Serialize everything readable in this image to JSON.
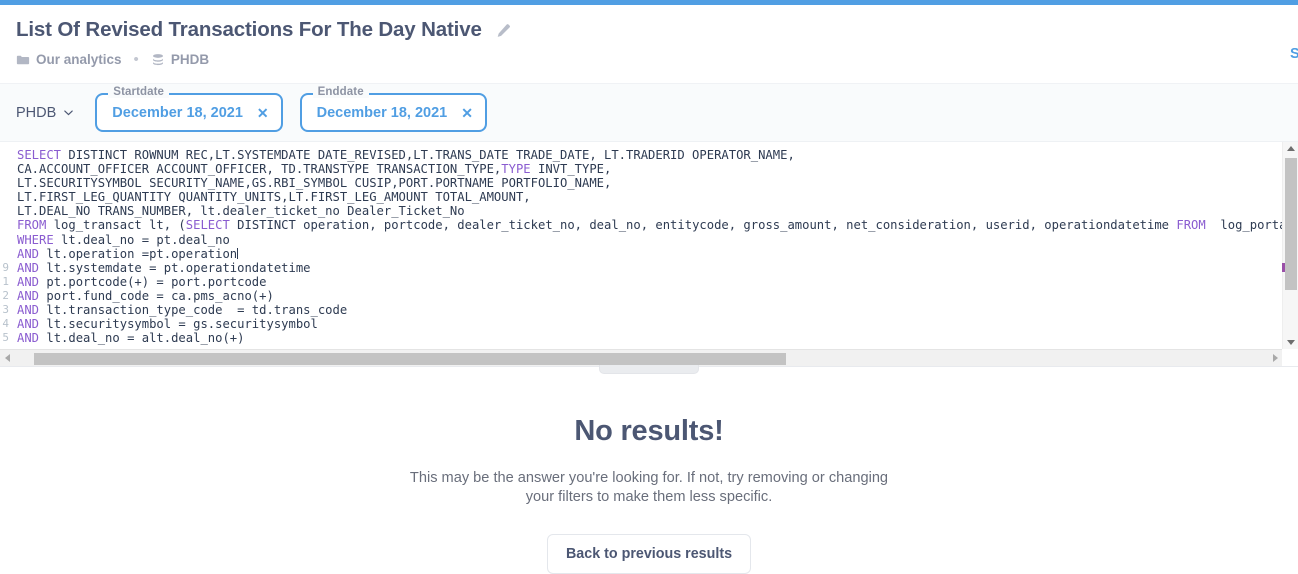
{
  "theme": {
    "accent": "#509ee3",
    "text_dark": "#4c5773",
    "text_muted": "#949aab",
    "keyword_purple": "#8a5cd0",
    "filter_bar_bg": "#f9fbfc"
  },
  "header": {
    "title": "List Of Revised Transactions For The Day Native",
    "edit_icon": "pencil-icon",
    "breadcrumb": {
      "collection": "Our analytics",
      "collection_icon": "folder-icon",
      "separator": "•",
      "database": "PHDB",
      "database_icon": "database-icon"
    },
    "right_link_clipped": "Save"
  },
  "filter_bar": {
    "database_picker": {
      "label": "PHDB",
      "chevron_icon": "chevron-down-icon"
    },
    "filters": [
      {
        "legend": "Startdate",
        "value": "December 18, 2021",
        "clear_icon": "✕"
      },
      {
        "legend": "Enddate",
        "value": "December 18, 2021",
        "clear_icon": "✕"
      }
    ]
  },
  "editor": {
    "language": "sql",
    "gutter_line_numbers": [
      "",
      "",
      "",
      "",
      "",
      "",
      "",
      "",
      "9",
      "1",
      "2",
      "3",
      "4",
      "5"
    ],
    "scrollbars": {
      "vertical_thumb_pct": 63,
      "horizontal_thumb_pct": 60,
      "up_icon": "triangle-up-icon",
      "down_icon": "triangle-down-icon",
      "left_icon": "triangle-left-icon",
      "right_icon": "triangle-right-icon"
    },
    "lines": [
      [
        {
          "t": "SELECT",
          "k": true
        },
        {
          "t": " DISTINCT ROWNUM REC,LT.SYSTEMDATE DATE_REVISED,LT.TRANS_DATE TRADE_DATE, LT.TRADERID OPERATOR_NAME,",
          "k": false
        }
      ],
      [
        {
          "t": "CA.ACCOUNT_OFFICER ACCOUNT_OFFICER, TD.TRANSTYPE TRANSACTION_TYPE,",
          "k": false
        },
        {
          "t": "TYPE",
          "k": true
        },
        {
          "t": " INVT_TYPE,",
          "k": false
        }
      ],
      [
        {
          "t": "LT.SECURITYSYMBOL SECURITY_NAME,GS.RBI_SYMBOL CUSIP,PORT.PORTNAME PORTFOLIO_NAME,",
          "k": false
        }
      ],
      [
        {
          "t": "LT.FIRST_LEG_QUANTITY QUANTITY_UNITS,LT.FIRST_LEG_AMOUNT TOTAL_AMOUNT,",
          "k": false
        }
      ],
      [
        {
          "t": "LT.DEAL_NO TRANS_NUMBER, lt.dealer_ticket_no Dealer_Ticket_No",
          "k": false
        }
      ],
      [
        {
          "t": "FROM",
          "k": true
        },
        {
          "t": " log_transact lt, (",
          "k": false
        },
        {
          "t": "SELECT",
          "k": true
        },
        {
          "t": " DISTINCT operation, portcode, dealer_ticket_no, deal_no, entitycode, gross_amount, net_consideration, userid, operationdatetime ",
          "k": false
        },
        {
          "t": "FROM",
          "k": true
        },
        {
          "t": "  log_portallocation) pt, ",
          "k": false
        }
      ],
      [
        {
          "t": "WHERE",
          "k": true
        },
        {
          "t": " lt.deal_no = pt.deal_no",
          "k": false
        }
      ],
      [
        {
          "t": "AND",
          "k": true
        },
        {
          "t": " lt.operation =pt.operation",
          "k": false
        },
        {
          "t": "|CARET|",
          "k": false
        }
      ],
      [
        {
          "t": "AND",
          "k": true
        },
        {
          "t": " lt.systemdate = pt.operationdatetime",
          "k": false
        }
      ],
      [
        {
          "t": "AND",
          "k": true
        },
        {
          "t": " pt.portcode(+) = port.portcode",
          "k": false
        }
      ],
      [
        {
          "t": "AND",
          "k": true
        },
        {
          "t": " port.fund_code = ca.pms_acno(+)",
          "k": false
        }
      ],
      [
        {
          "t": "AND",
          "k": true
        },
        {
          "t": " lt.transaction_type_code  = td.trans_code",
          "k": false
        }
      ],
      [
        {
          "t": "AND",
          "k": true
        },
        {
          "t": " lt.securitysymbol = gs.securitysymbol",
          "k": false
        }
      ],
      [
        {
          "t": "AND",
          "k": true
        },
        {
          "t": " lt.deal_no = alt.deal_no(+)",
          "k": false
        }
      ]
    ]
  },
  "results": {
    "title": "No results!",
    "subtitle": "This may be the answer you're looking for. If not, try removing or changing your filters to make them less specific.",
    "back_button": "Back to previous results"
  }
}
